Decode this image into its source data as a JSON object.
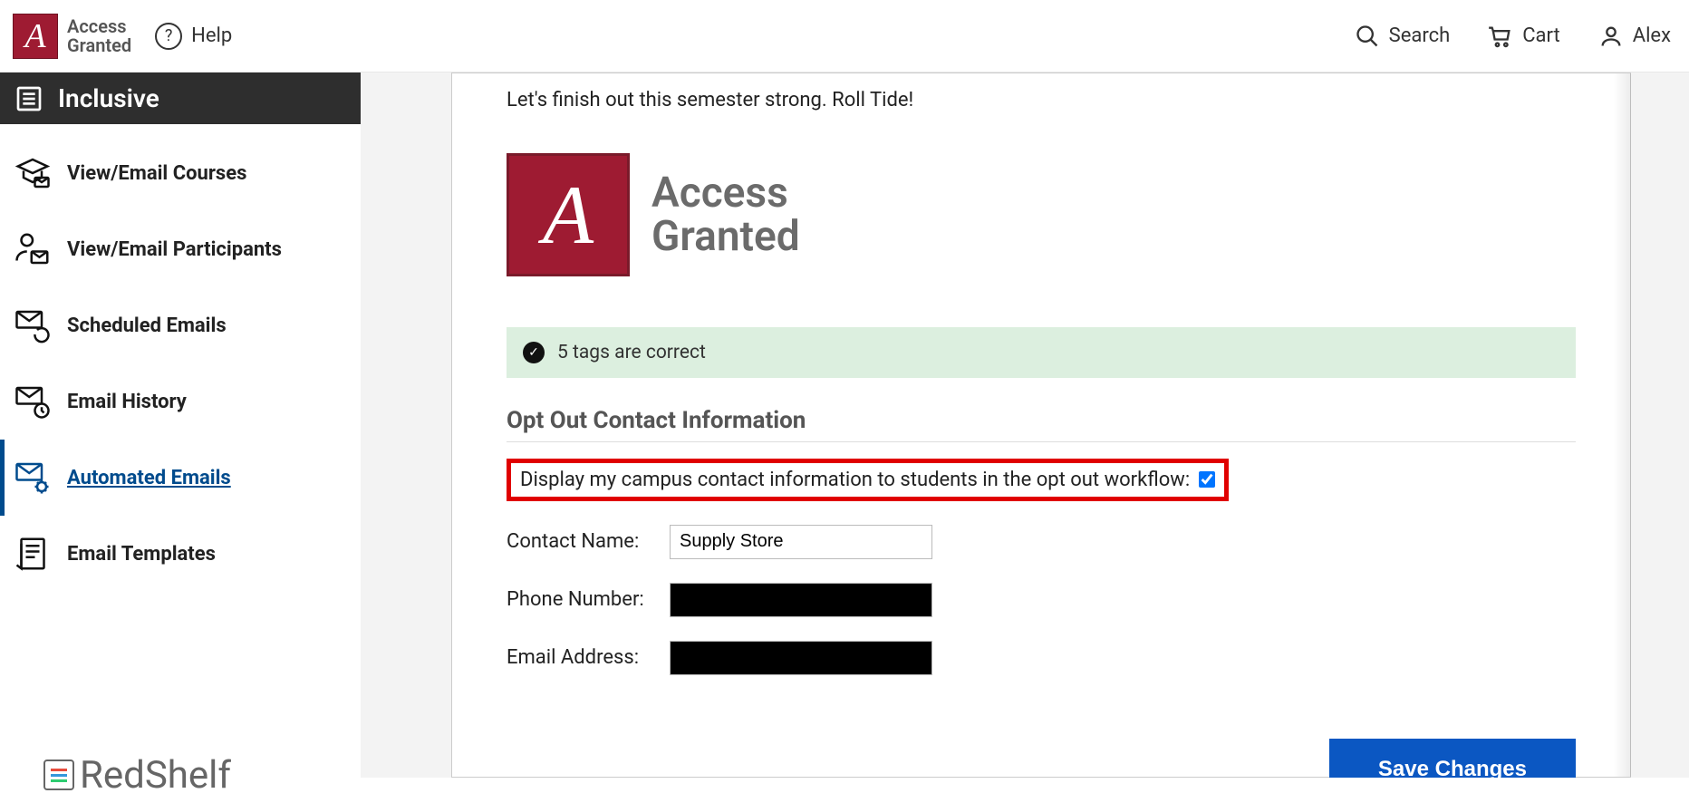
{
  "header": {
    "brand_top": "Access",
    "brand_bottom": "Granted",
    "help": "Help",
    "search": "Search",
    "cart": "Cart",
    "user": "Alex"
  },
  "sidebar": {
    "section_title": "Inclusive",
    "items": [
      {
        "label": "View/Email Courses"
      },
      {
        "label": "View/Email Participants"
      },
      {
        "label": "Scheduled Emails"
      },
      {
        "label": "Email History"
      },
      {
        "label": "Automated Emails"
      },
      {
        "label": "Email Templates"
      }
    ],
    "footer_brand": "RedShelf"
  },
  "main": {
    "intro_line": "Let's finish out this semester strong. Roll Tide!",
    "access_logo_top": "Access",
    "access_logo_bottom": "Granted",
    "tag_banner": "5 tags are correct",
    "section_title": "Opt Out Contact Information",
    "checkbox_label": "Display my campus contact information to students in the opt out workflow:",
    "contact_name_label": "Contact Name:",
    "contact_name_value": "Supply Store",
    "phone_label": "Phone Number:",
    "email_label": "Email Address:",
    "save_button": "Save Changes"
  }
}
